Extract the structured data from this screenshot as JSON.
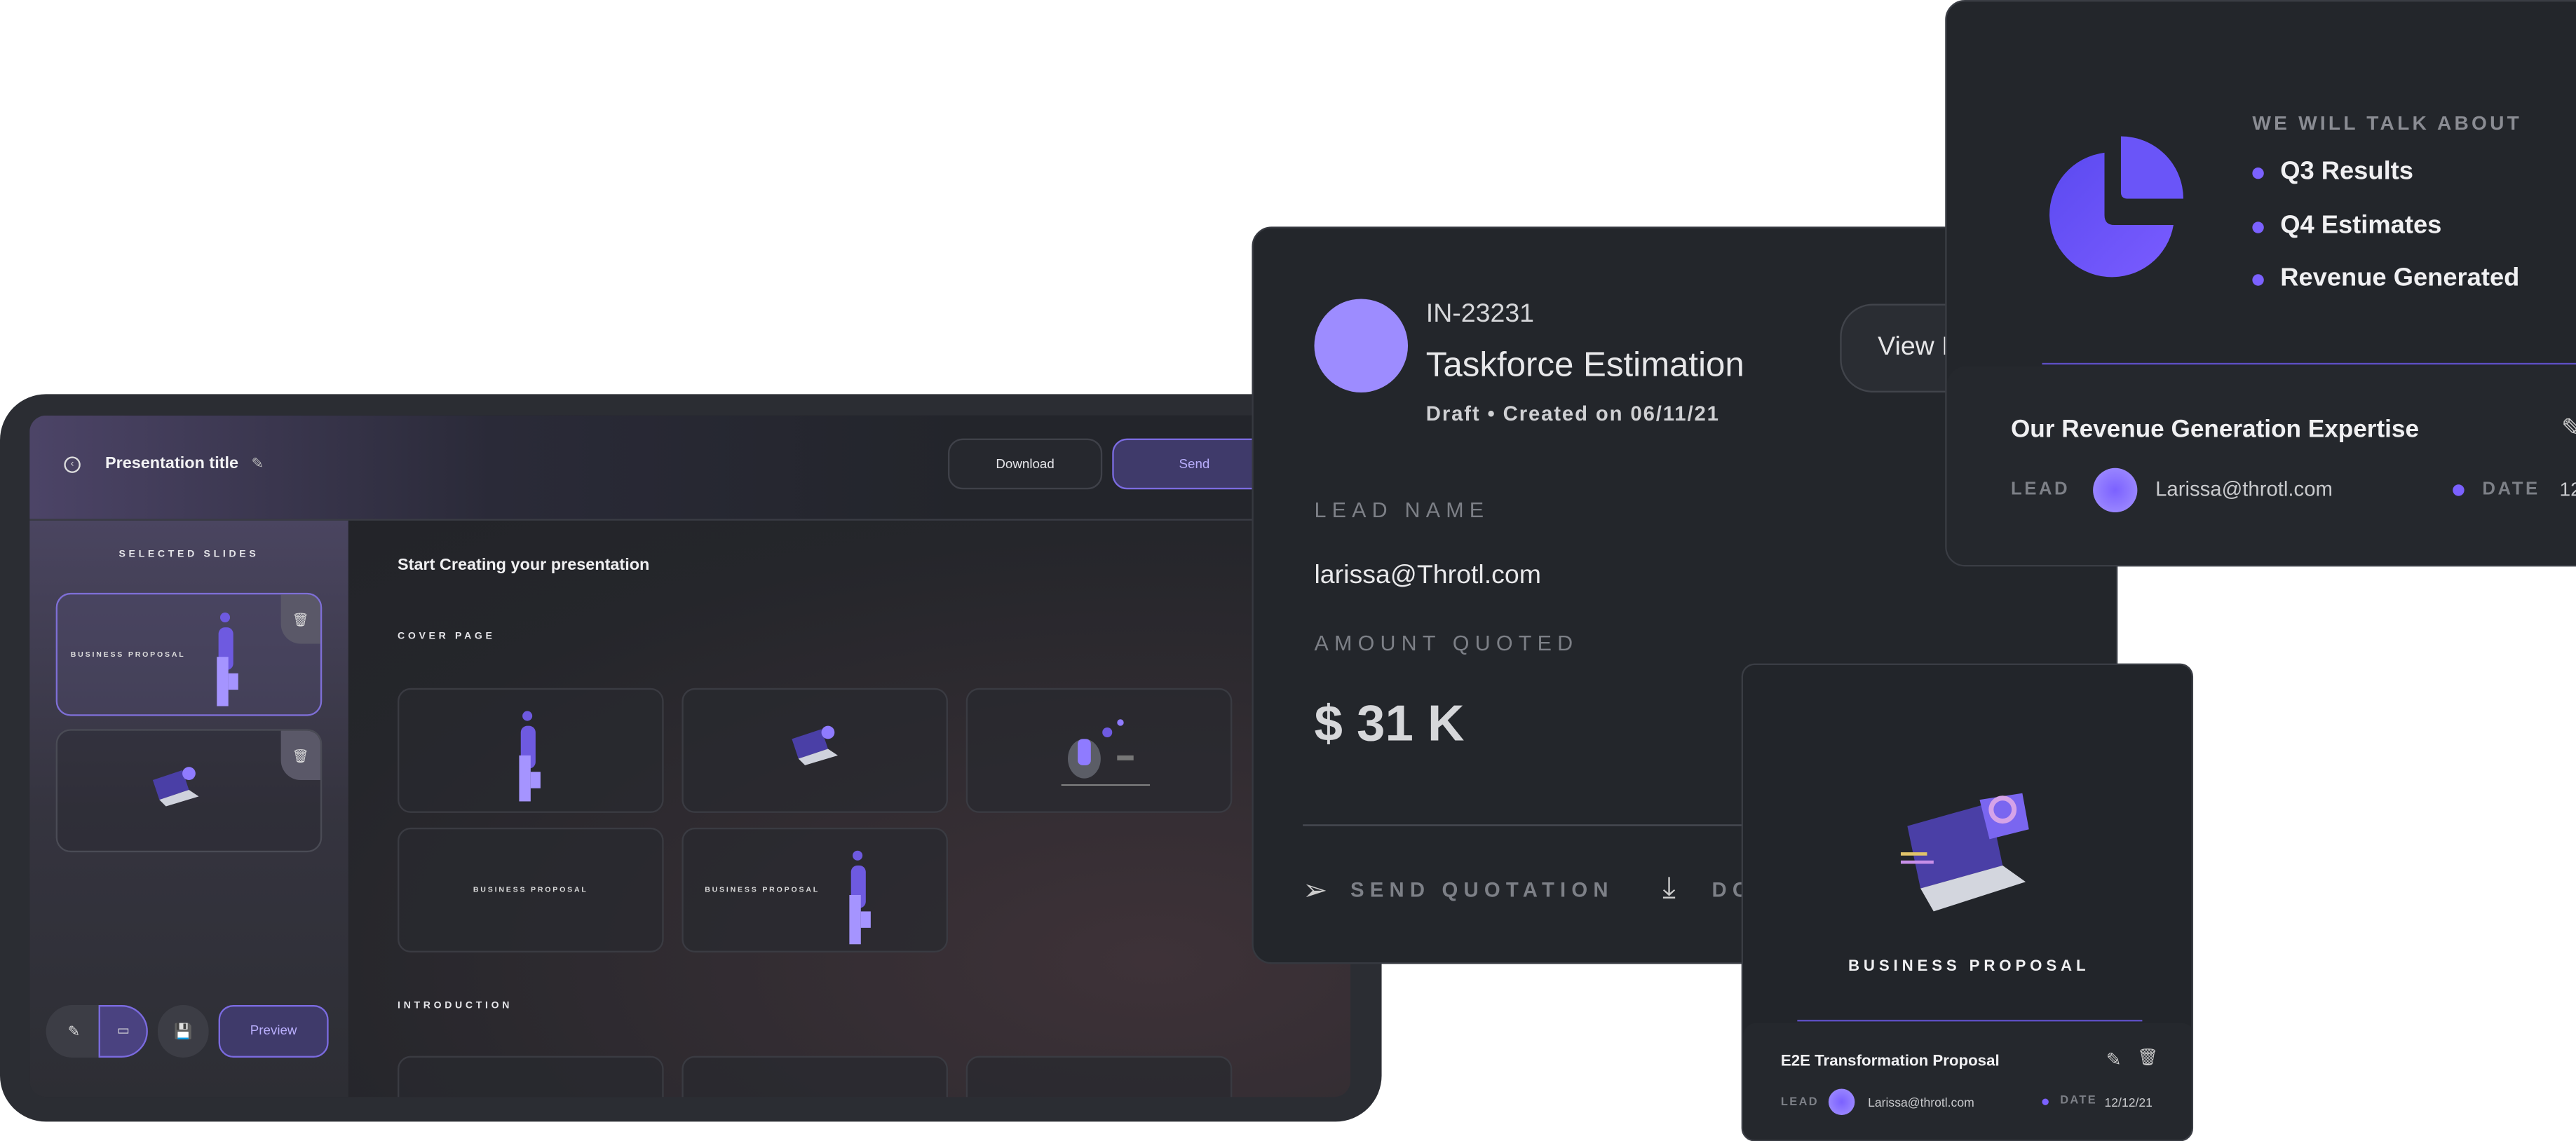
{
  "presentation_app": {
    "header": {
      "title": "Presentation title",
      "download_label": "Download",
      "send_label": "Send"
    },
    "sidebar": {
      "heading": "SELECTED SLIDES",
      "slides": [
        {
          "label": "BUSINESS PROPOSAL"
        },
        {
          "label": ""
        }
      ],
      "preview_label": "Preview"
    },
    "main": {
      "heading": "Start Creating your presentation",
      "sections": [
        {
          "title": "COVER PAGE",
          "thumbs": [
            "",
            "",
            "",
            "BUSINESS PROPOSAL",
            "BUSINESS PROPOSAL"
          ]
        },
        {
          "title": "INTRODUCTION"
        }
      ]
    }
  },
  "invoice_card": {
    "id": "IN-23231",
    "title": "Taskforce Estimation",
    "status": "Draft • Created on 06/11/21",
    "view_label": "View I",
    "lead_label": "LEAD NAME",
    "lead_value": "larissa@Throtl.com",
    "amount_label": "AMOUNT QUOTED",
    "amount_value": "$ 31 K",
    "send_label": "SEND QUOTATION",
    "download_label": "DO"
  },
  "agenda_card": {
    "heading": "WE WILL TALK ABOUT",
    "items": [
      "Q3 Results",
      "Q4 Estimates",
      "Revenue Generated"
    ],
    "title": "Our Revenue Generation Expertise",
    "lead_label": "LEAD",
    "lead_value": "Larissa@throtl.com",
    "date_label": "DATE",
    "date_value": "12"
  },
  "proposal_card": {
    "cover_label": "BUSINESS PROPOSAL",
    "title": "E2E Transformation Proposal",
    "lead_label": "LEAD",
    "lead_value": "Larissa@throtl.com",
    "date_label": "DATE",
    "date_value": "12/12/21"
  },
  "colors": {
    "accent": "#7b61ff",
    "avatar": "#9d8cff",
    "card_bg": "#23262b"
  }
}
